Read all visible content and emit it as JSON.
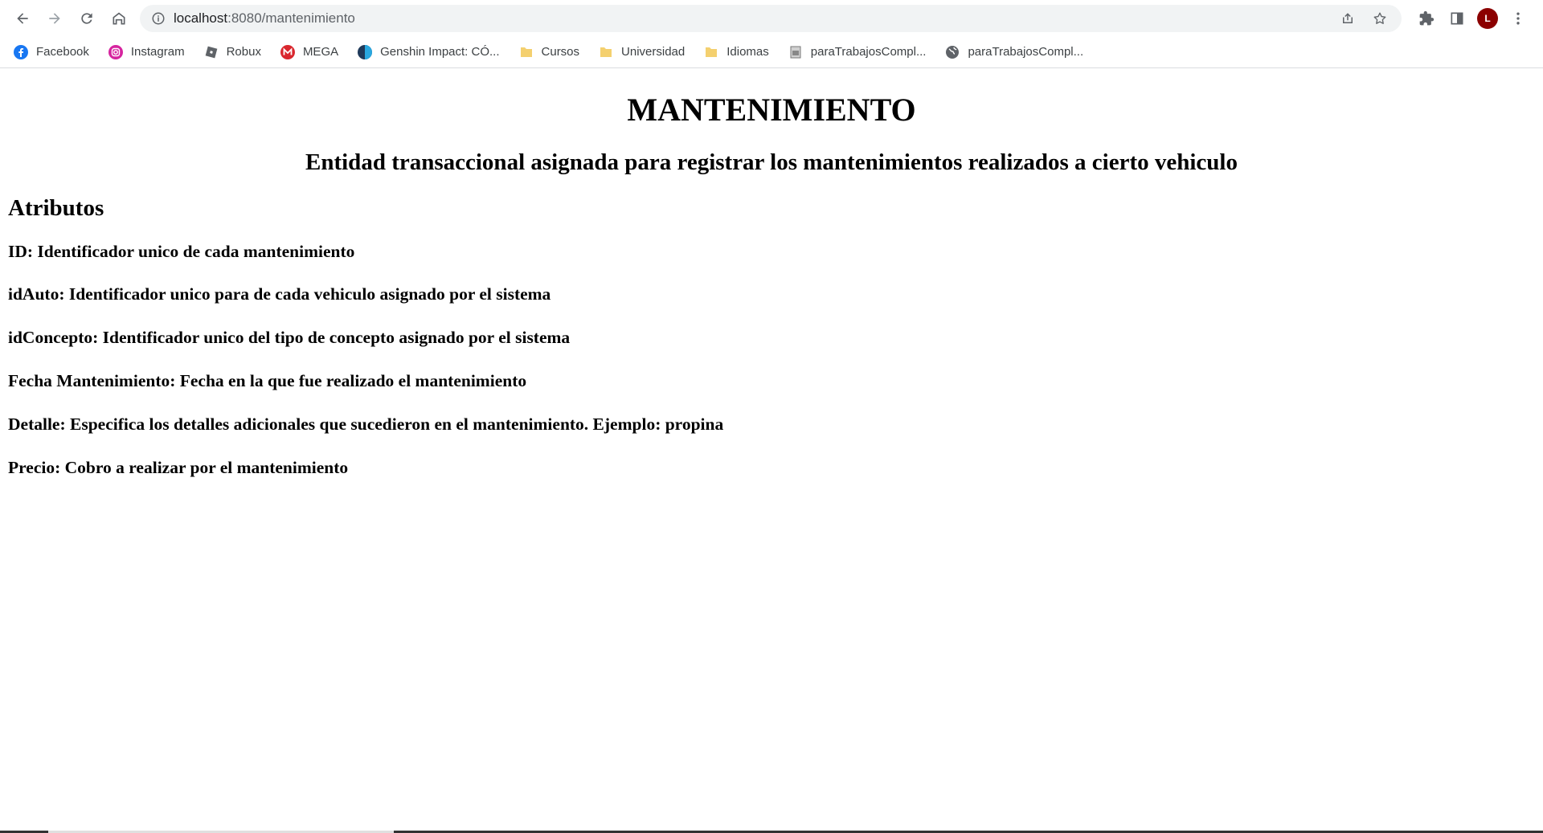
{
  "browser": {
    "url_host": "localhost",
    "url_rest": ":8080/mantenimiento",
    "avatar_letter": "L"
  },
  "bookmarks": [
    {
      "label": "Facebook",
      "icon": "facebook-icon"
    },
    {
      "label": "Instagram",
      "icon": "instagram-icon"
    },
    {
      "label": "Robux",
      "icon": "robux-icon"
    },
    {
      "label": "MEGA",
      "icon": "mega-icon"
    },
    {
      "label": "Genshin Impact: CÓ...",
      "icon": "genshin-icon"
    },
    {
      "label": "Cursos",
      "icon": "folder-icon"
    },
    {
      "label": "Universidad",
      "icon": "folder-icon"
    },
    {
      "label": "Idiomas",
      "icon": "folder-icon"
    },
    {
      "label": "paraTrabajosCompl...",
      "icon": "page-icon"
    },
    {
      "label": "paraTrabajosCompl...",
      "icon": "globe-icon"
    }
  ],
  "page": {
    "title": "MANTENIMIENTO",
    "subtitle": "Entidad transaccional asignada para registrar los mantenimientos realizados a cierto vehiculo",
    "attributes_heading": "Atributos",
    "attributes": [
      "ID: Identificador unico de cada mantenimiento",
      "idAuto: Identificador unico para de cada vehiculo asignado por el sistema",
      "idConcepto: Identificador unico del tipo de concepto asignado por el sistema",
      "Fecha Mantenimiento: Fecha en la que fue realizado el mantenimiento",
      "Detalle: Especifica los detalles adicionales que sucedieron en el mantenimiento. Ejemplo: propina",
      "Precio: Cobro a realizar por el mantenimiento"
    ]
  },
  "colors": {
    "omnibox_bg": "#f1f3f4",
    "avatar_bg": "#8b0000",
    "folder": "#f4d06f"
  }
}
